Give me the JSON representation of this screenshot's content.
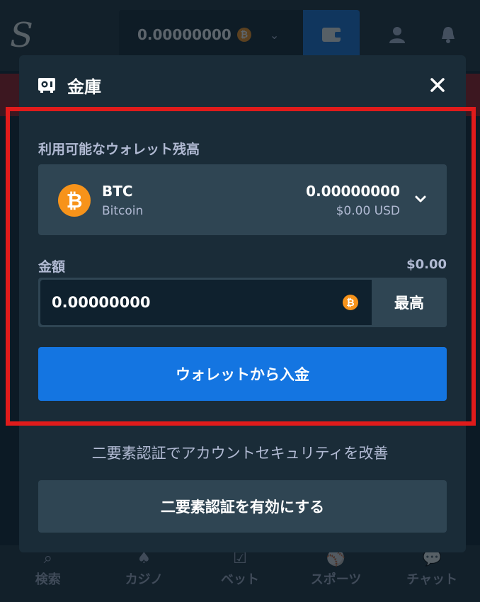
{
  "topbar": {
    "logo": "S",
    "balance": "0.00000000",
    "balance_coin": "₿"
  },
  "bottom_nav": [
    {
      "label": "検索"
    },
    {
      "label": "カジノ"
    },
    {
      "label": "ベット"
    },
    {
      "label": "スポーツ"
    },
    {
      "label": "チャット"
    }
  ],
  "modal": {
    "title": "金庫",
    "wallet_label": "利用可能なウォレット残高",
    "wallet": {
      "coin_symbol": "₿",
      "code": "BTC",
      "name": "Bitcoin",
      "amount": "0.00000000",
      "usd": "$0.00 USD"
    },
    "amount_label": "金額",
    "amount_usd": "$0.00",
    "amount_value": "0.00000000",
    "input_coin": "₿",
    "max_label": "最高",
    "deposit_label": "ウォレットから入金",
    "twofa_text": "二要素認証でアカウントセキュリティを改善",
    "twofa_button": "二要素認証を有効にする"
  },
  "colors": {
    "background": "#0f212e",
    "panel": "#1a2c38",
    "field": "#2f4553",
    "primary": "#1475e1",
    "bitcoin": "#f7931a",
    "highlight": "#e01b1b",
    "muted_text": "#b1bad3"
  }
}
